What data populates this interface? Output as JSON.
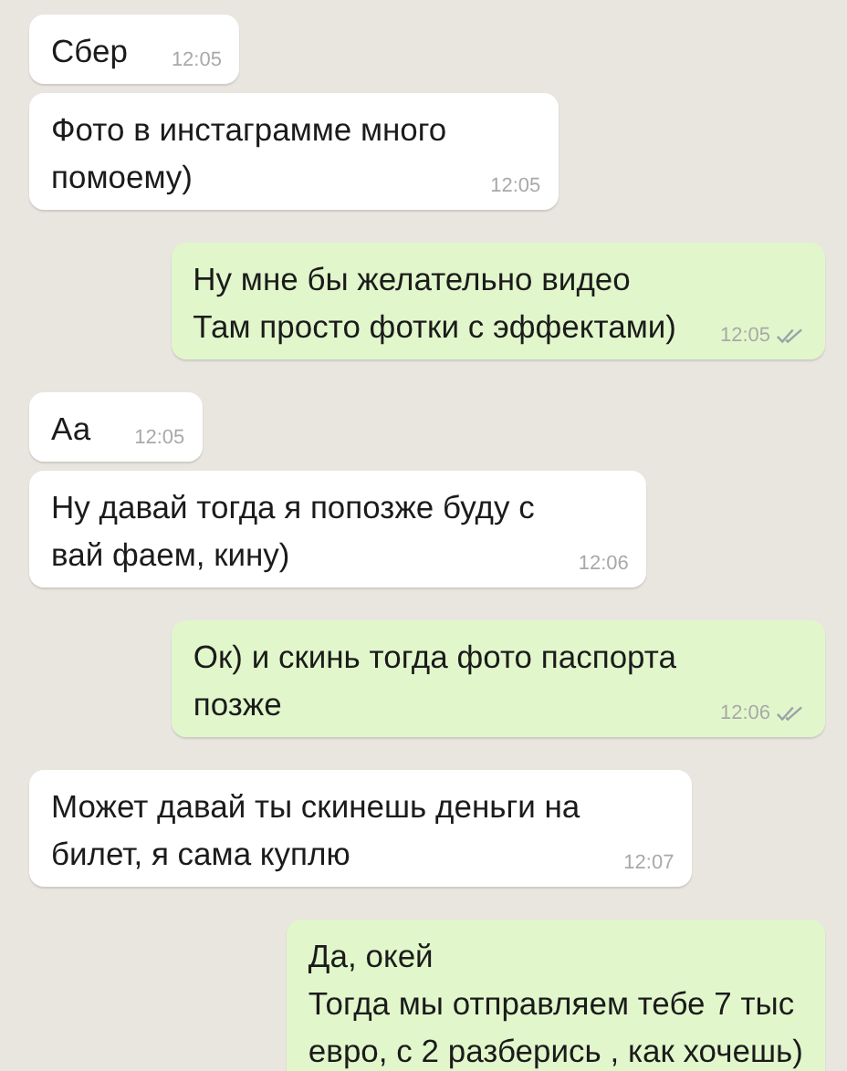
{
  "messages": [
    {
      "kind": "incoming",
      "text": "Сбер",
      "time": "12:05"
    },
    {
      "kind": "incoming",
      "text": "Фото в инстаграмме много\nпомоему)",
      "time": "12:05"
    },
    {
      "kind": "outgoing",
      "text": "Ну мне бы желательно видео\nТам просто фотки с эффектами)",
      "time": "12:05",
      "read": true
    },
    {
      "kind": "incoming",
      "text": "Аа",
      "time": "12:05"
    },
    {
      "kind": "incoming",
      "text": "Ну давай тогда я попозже буду с\nвай фаем, кину)",
      "time": "12:06"
    },
    {
      "kind": "outgoing",
      "text": "Ок) и скинь тогда фото паспорта\nпозже",
      "time": "12:06",
      "read": true
    },
    {
      "kind": "incoming",
      "text": "Может давай ты скинешь деньги на\nбилет, я сама куплю",
      "time": "12:07"
    },
    {
      "kind": "outgoing",
      "text": "Да, окей\nТогда мы отправляем тебе 7 тыс\nевро, с 2 разберись , как хочешь)"
    }
  ]
}
